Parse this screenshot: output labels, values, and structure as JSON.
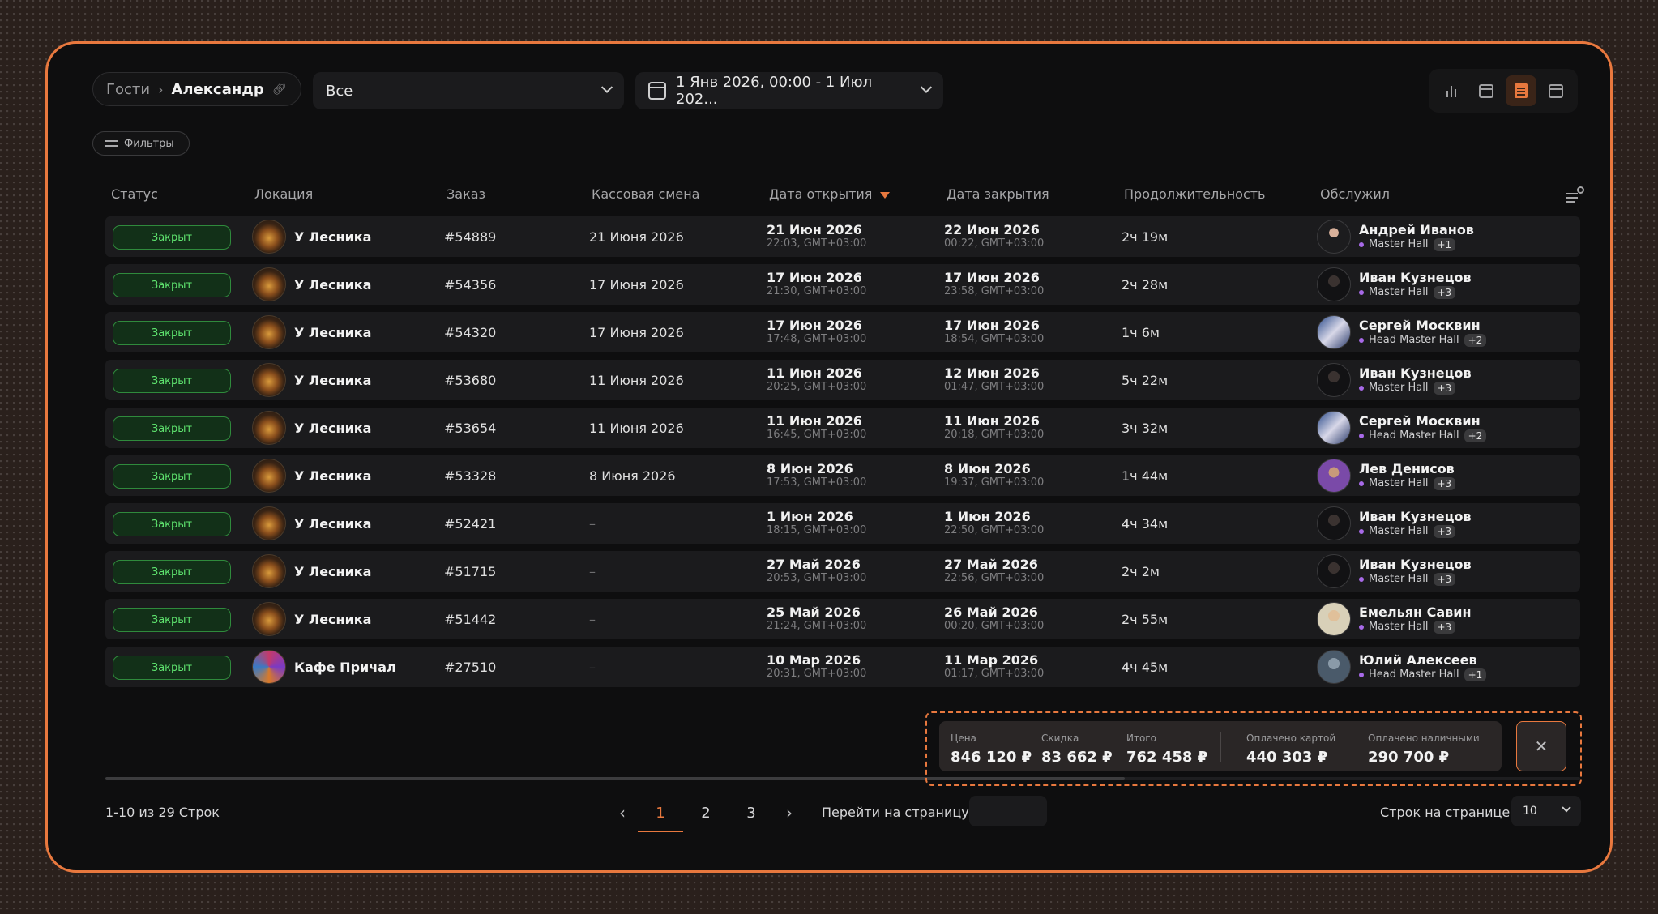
{
  "breadcrumb": {
    "parent": "Гости",
    "current": "Александр"
  },
  "filter_select": {
    "value": "Все"
  },
  "date_range": {
    "value": "1 Янв 2026, 00:00 - 1 Июл 202..."
  },
  "filters_button": "Фильтры",
  "columns": {
    "status": "Статус",
    "location": "Локация",
    "order": "Заказ",
    "shift": "Кассовая смена",
    "opened": "Дата открытия",
    "closed": "Дата закрытия",
    "duration": "Продолжительность",
    "served": "Обслужил"
  },
  "rows": [
    {
      "status": "Закрыт",
      "location": "У Лесника",
      "order": "#54889",
      "shift": "21 Июня 2026",
      "open_date": "21 Июн 2026",
      "open_time": "22:03, GMT+03:00",
      "close_date": "22 Июн 2026",
      "close_time": "00:22, GMT+03:00",
      "duration": "2ч 19м",
      "staff": "Андрей Иванов",
      "role": "Master Hall",
      "extra": "+1"
    },
    {
      "status": "Закрыт",
      "location": "У Лесника",
      "order": "#54356",
      "shift": "17 Июня 2026",
      "open_date": "17 Июн 2026",
      "open_time": "21:30, GMT+03:00",
      "close_date": "17 Июн 2026",
      "close_time": "23:58, GMT+03:00",
      "duration": "2ч 28м",
      "staff": "Иван Кузнецов",
      "role": "Master Hall",
      "extra": "+3"
    },
    {
      "status": "Закрыт",
      "location": "У Лесника",
      "order": "#54320",
      "shift": "17 Июня 2026",
      "open_date": "17 Июн 2026",
      "open_time": "17:48, GMT+03:00",
      "close_date": "17 Июн 2026",
      "close_time": "18:54, GMT+03:00",
      "duration": "1ч 6м",
      "staff": "Сергей Москвин",
      "role": "Head Master Hall",
      "extra": "+2"
    },
    {
      "status": "Закрыт",
      "location": "У Лесника",
      "order": "#53680",
      "shift": "11 Июня 2026",
      "open_date": "11 Июн 2026",
      "open_time": "20:25, GMT+03:00",
      "close_date": "12 Июн 2026",
      "close_time": "01:47, GMT+03:00",
      "duration": "5ч 22м",
      "staff": "Иван Кузнецов",
      "role": "Master Hall",
      "extra": "+3"
    },
    {
      "status": "Закрыт",
      "location": "У Лесника",
      "order": "#53654",
      "shift": "11 Июня 2026",
      "open_date": "11 Июн 2026",
      "open_time": "16:45, GMT+03:00",
      "close_date": "11 Июн 2026",
      "close_time": "20:18, GMT+03:00",
      "duration": "3ч 32м",
      "staff": "Сергей Москвин",
      "role": "Head Master Hall",
      "extra": "+2"
    },
    {
      "status": "Закрыт",
      "location": "У Лесника",
      "order": "#53328",
      "shift": "8 Июня 2026",
      "open_date": "8 Июн 2026",
      "open_time": "17:53, GMT+03:00",
      "close_date": "8 Июн 2026",
      "close_time": "19:37, GMT+03:00",
      "duration": "1ч 44м",
      "staff": "Лев Денисов",
      "role": "Master Hall",
      "extra": "+3"
    },
    {
      "status": "Закрыт",
      "location": "У Лесника",
      "order": "#52421",
      "shift": "–",
      "open_date": "1 Июн 2026",
      "open_time": "18:15, GMT+03:00",
      "close_date": "1 Июн 2026",
      "close_time": "22:50, GMT+03:00",
      "duration": "4ч 34м",
      "staff": "Иван Кузнецов",
      "role": "Master Hall",
      "extra": "+3"
    },
    {
      "status": "Закрыт",
      "location": "У Лесника",
      "order": "#51715",
      "shift": "–",
      "open_date": "27 Май 2026",
      "open_time": "20:53, GMT+03:00",
      "close_date": "27 Май 2026",
      "close_time": "22:56, GMT+03:00",
      "duration": "2ч 2м",
      "staff": "Иван Кузнецов",
      "role": "Master Hall",
      "extra": "+3"
    },
    {
      "status": "Закрыт",
      "location": "У Лесника",
      "order": "#51442",
      "shift": "–",
      "open_date": "25 Май 2026",
      "open_time": "21:24, GMT+03:00",
      "close_date": "26 Май 2026",
      "close_time": "00:20, GMT+03:00",
      "duration": "2ч 55м",
      "staff": "Емельян Савин",
      "role": "Master Hall",
      "extra": "+3"
    },
    {
      "status": "Закрыт",
      "location": "Кафе Причал",
      "order": "#27510",
      "shift": "–",
      "open_date": "10 Мар 2026",
      "open_time": "20:31, GMT+03:00",
      "close_date": "11 Мар 2026",
      "close_time": "01:17, GMT+03:00",
      "duration": "4ч 45м",
      "staff": "Юлий Алексеев",
      "role": "Head Master Hall",
      "extra": "+1"
    }
  ],
  "totals": {
    "price_label": "Цена",
    "price": "846 120 ₽",
    "discount_label": "Скидка",
    "discount": "83 662 ₽",
    "total_label": "Итого",
    "total": "762 458 ₽",
    "card_label": "Оплачено картой",
    "card": "440 303 ₽",
    "cash_label": "Оплачено наличными",
    "cash": "290 700 ₽"
  },
  "pagination": {
    "info": "1-10 из 29 Строк",
    "pages": [
      "1",
      "2",
      "3"
    ],
    "goto_label": "Перейти на страницу",
    "rows_per_page_label": "Строк на странице",
    "rows_per_page": "10"
  },
  "colors": {
    "accent": "#e8783e",
    "status_green": "#5ee36e",
    "role_dot": "#a86ae8"
  }
}
